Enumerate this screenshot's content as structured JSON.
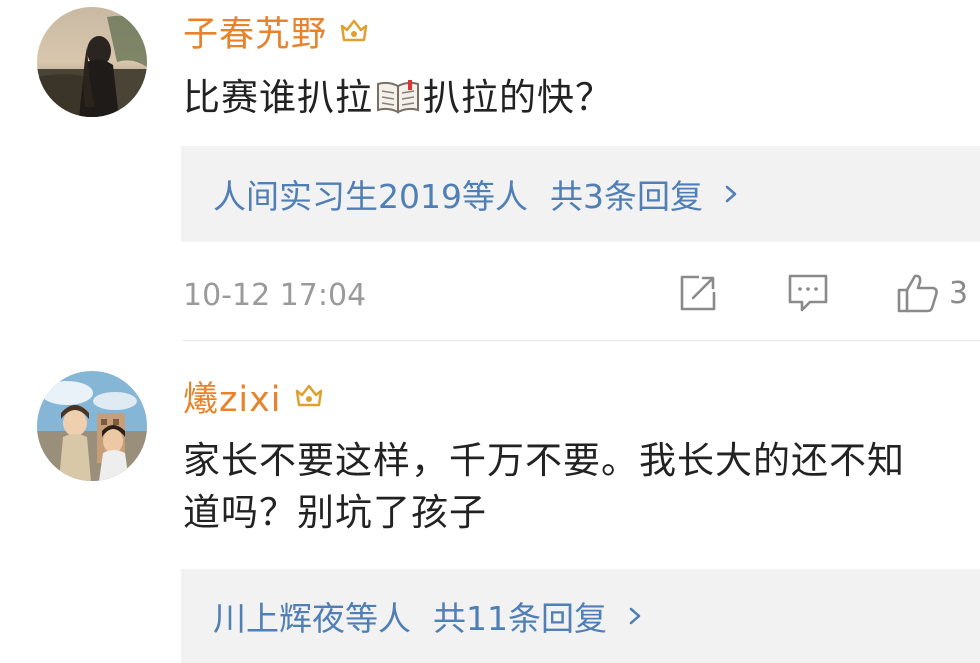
{
  "comments": [
    {
      "username": "子春艽野",
      "text_before_emoji": "比赛谁扒拉",
      "text_after_emoji": "扒拉的快？",
      "emoji": "book-emoji",
      "reply_preview": {
        "users": "人间实习生2019等人",
        "count": "共3条回复"
      },
      "timestamp": "10-12 17:04",
      "likes": "3"
    },
    {
      "username": "爔zixi",
      "text_line1": "家长不要这样，千万不要。我长大的还不知",
      "text_line2": "道吗？别坑了孩子",
      "reply_preview": {
        "users": "川上辉夜等人",
        "count": "共11条回复"
      }
    }
  ],
  "colors": {
    "username": "#e8832b",
    "link": "#4f7fb5",
    "text": "#222222",
    "meta": "#9a9a9a",
    "reply_bg": "#f2f2f2"
  },
  "icons": [
    "vip-crown-icon",
    "chevron-right-icon",
    "share-icon",
    "comment-icon",
    "like-icon"
  ]
}
